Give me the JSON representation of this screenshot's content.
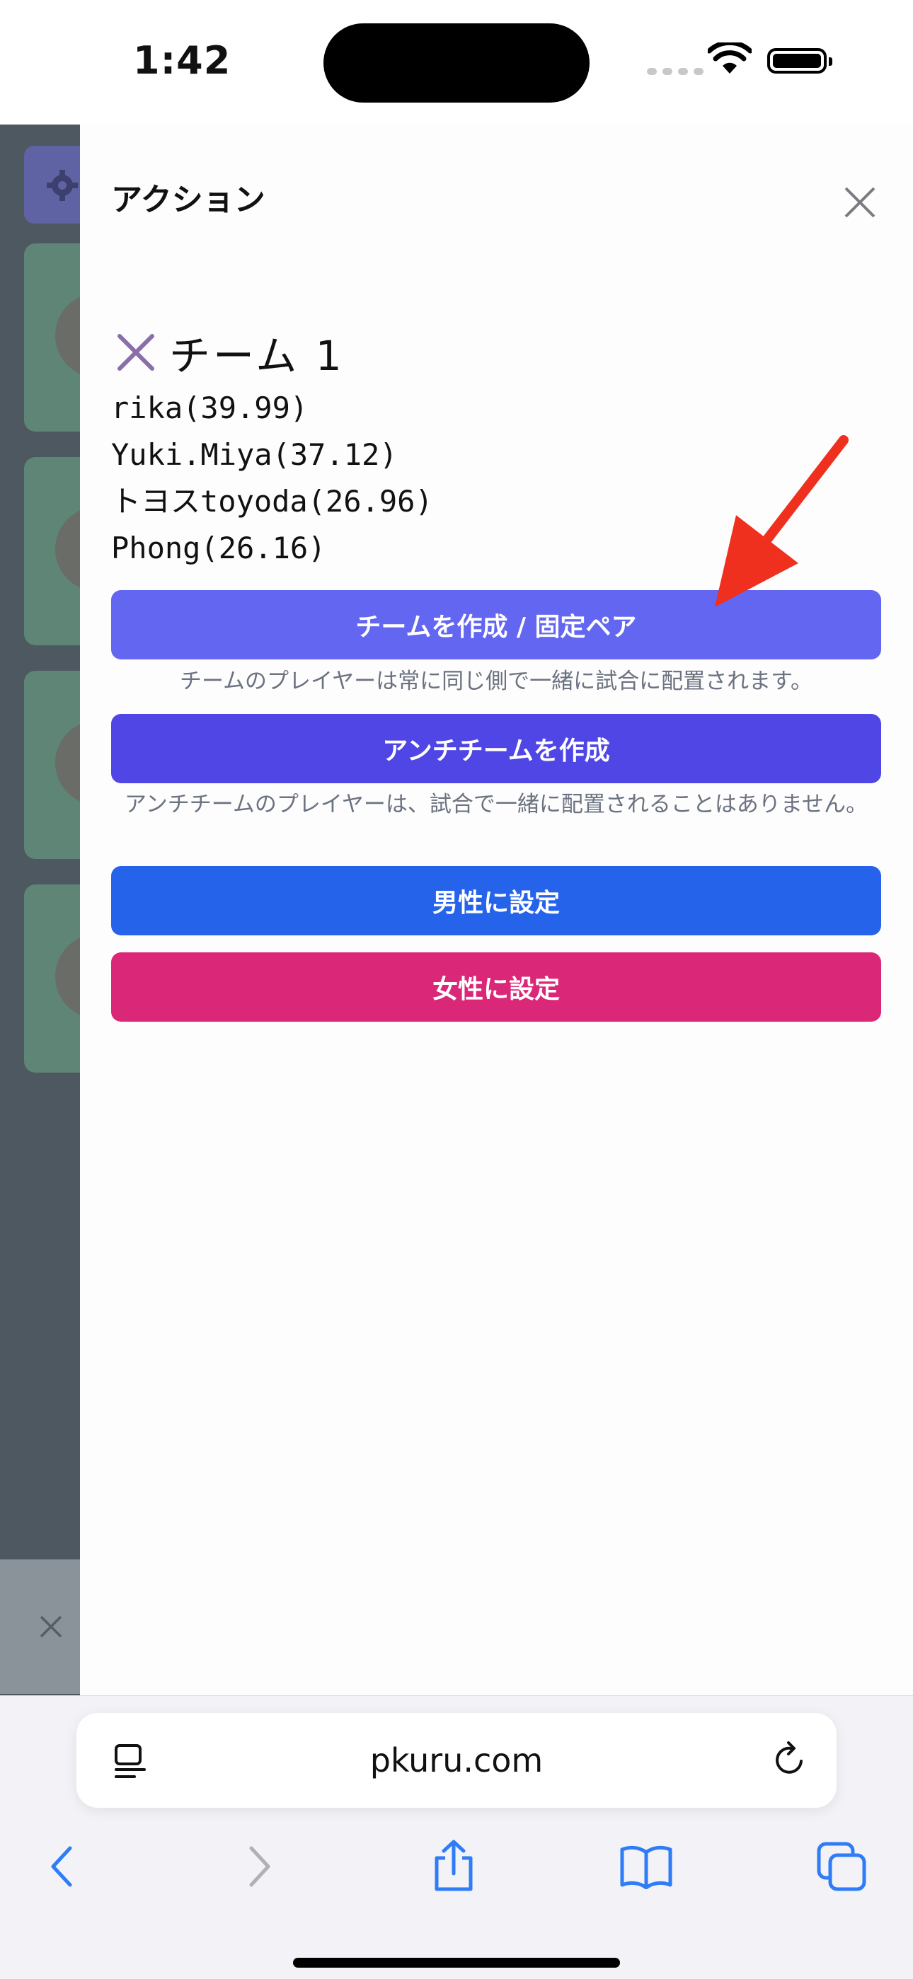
{
  "status": {
    "time": "1:42"
  },
  "panel": {
    "title": "アクション",
    "team": {
      "name": "チーム 1",
      "players": [
        "rika(39.99)",
        "Yuki.Miya(37.12)",
        "トヨスtoyoda(26.96)",
        "Phong(26.16)"
      ]
    },
    "buttons": {
      "create_team": "チームを作成 / 固定ペア",
      "create_team_hint": "チームのプレイヤーは常に同じ側で一緒に試合に配置されます。",
      "create_anti_team": "アンチチームを作成",
      "create_anti_team_hint": "アンチチームのプレイヤーは、試合で一緒に配置されることはありません。",
      "set_male": "男性に設定",
      "set_female": "女性に設定"
    }
  },
  "browser": {
    "url": "pkuru.com"
  },
  "colors": {
    "create_team": "#6366f1",
    "create_anti_team": "#4f46e5",
    "set_male": "#2563eb",
    "set_female": "#db2777",
    "annotation_arrow": "#f0301e"
  },
  "icons": [
    "gear-icon",
    "close-icon",
    "remove-x-icon",
    "arrow-annotation",
    "reader-icon",
    "reload-icon",
    "back-icon",
    "forward-icon",
    "share-icon",
    "bookmarks-icon",
    "tabs-icon"
  ]
}
